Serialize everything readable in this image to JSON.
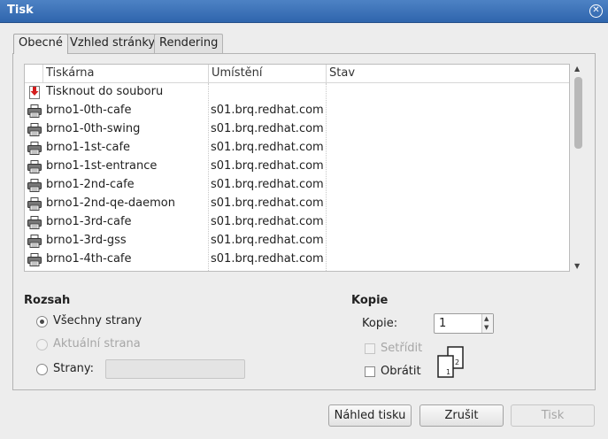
{
  "window": {
    "title": "Tisk",
    "close_icon": "close-icon"
  },
  "tabs": [
    {
      "label": "Obecné",
      "active": true
    },
    {
      "label": "Vzhled stránky",
      "active": false
    },
    {
      "label": "Rendering",
      "active": false
    }
  ],
  "printer_list": {
    "columns": [
      "Tiskárna",
      "Umístění",
      "Stav"
    ],
    "rows": [
      {
        "icon": "print-to-file-icon",
        "name": "Tisknout do souboru",
        "location": "",
        "status": ""
      },
      {
        "icon": "printer-icon",
        "name": "brno1-0th-cafe",
        "location": "s01.brq.redhat.com",
        "status": ""
      },
      {
        "icon": "printer-icon",
        "name": "brno1-0th-swing",
        "location": "s01.brq.redhat.com",
        "status": ""
      },
      {
        "icon": "printer-icon",
        "name": "brno1-1st-cafe",
        "location": "s01.brq.redhat.com",
        "status": ""
      },
      {
        "icon": "printer-icon",
        "name": "brno1-1st-entrance",
        "location": "s01.brq.redhat.com",
        "status": ""
      },
      {
        "icon": "printer-icon",
        "name": "brno1-2nd-cafe",
        "location": "s01.brq.redhat.com",
        "status": ""
      },
      {
        "icon": "printer-icon",
        "name": "brno1-2nd-qe-daemon",
        "location": "s01.brq.redhat.com",
        "status": ""
      },
      {
        "icon": "printer-icon",
        "name": "brno1-3rd-cafe",
        "location": "s01.brq.redhat.com",
        "status": ""
      },
      {
        "icon": "printer-icon",
        "name": "brno1-3rd-gss",
        "location": "s01.brq.redhat.com",
        "status": ""
      },
      {
        "icon": "printer-icon",
        "name": "brno1-4th-cafe",
        "location": "s01.brq.redhat.com",
        "status": ""
      }
    ]
  },
  "range": {
    "title": "Rozsah",
    "all_pages": "Všechny strany",
    "current_page": "Aktuální strana",
    "pages": "Strany:",
    "pages_value": "",
    "selected": "all_pages"
  },
  "copies": {
    "title": "Kopie",
    "copies_label": "Kopie:",
    "copies_value": "1",
    "collate": "Setřídit",
    "collate_checked": false,
    "collate_disabled": true,
    "reverse": "Obrátit",
    "reverse_checked": false,
    "collate_preview_pages": [
      "1",
      "2"
    ]
  },
  "buttons": {
    "preview": "Náhled tisku",
    "cancel": "Zrušit",
    "print": "Tisk"
  }
}
